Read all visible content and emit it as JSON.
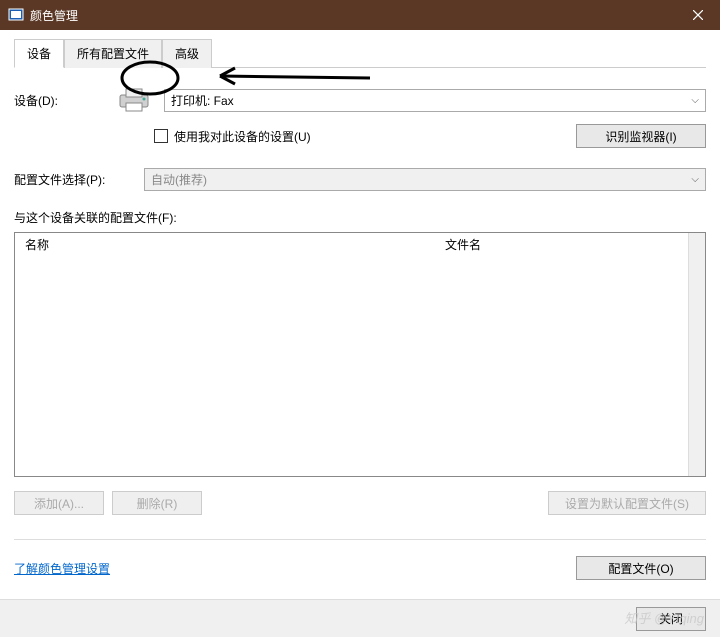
{
  "titlebar": {
    "title": "颜色管理"
  },
  "tabs": {
    "devices": "设备",
    "allProfiles": "所有配置文件",
    "advanced": "高级"
  },
  "device": {
    "label": "设备(D):",
    "selected": "打印机: Fax"
  },
  "useMySettings": {
    "label": "使用我对此设备的设置(U)"
  },
  "identifyMonitors": "识别监视器(I)",
  "profileSelect": {
    "label": "配置文件选择(P):",
    "selected": "自动(推荐)"
  },
  "associatedLabel": "与这个设备关联的配置文件(F):",
  "listHeaders": {
    "name": "名称",
    "filename": "文件名"
  },
  "buttons": {
    "add": "添加(A)...",
    "remove": "删除(R)",
    "setDefault": "设置为默认配置文件(S)",
    "profiles": "配置文件(O)",
    "close": "关闭"
  },
  "link": "了解颜色管理设置",
  "watermark": "知乎 @Ytqing"
}
